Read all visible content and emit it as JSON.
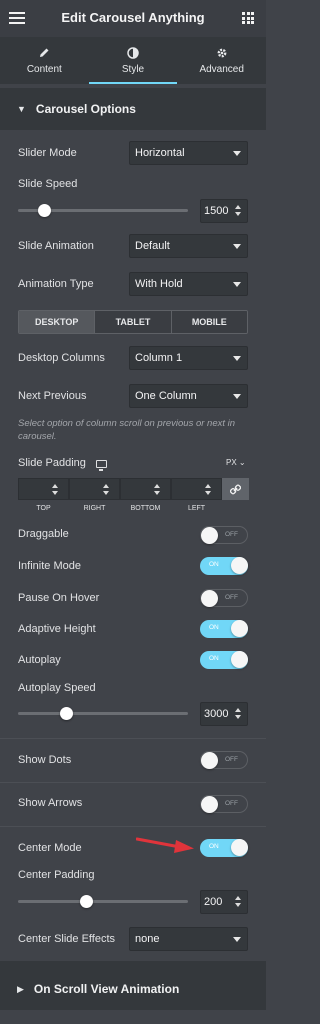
{
  "header": {
    "title": "Edit Carousel Anything"
  },
  "tabs": [
    {
      "label": "Content",
      "icon": "pencil-icon"
    },
    {
      "label": "Style",
      "icon": "contrast-icon"
    },
    {
      "label": "Advanced",
      "icon": "gear-icon"
    }
  ],
  "section": {
    "title": "Carousel Options"
  },
  "slider_mode": {
    "label": "Slider Mode",
    "value": "Horizontal"
  },
  "slide_speed": {
    "label": "Slide Speed",
    "value": "1500",
    "fraction": 0.15
  },
  "slide_animation": {
    "label": "Slide Animation",
    "value": "Default"
  },
  "animation_type": {
    "label": "Animation Type",
    "value": "With Hold"
  },
  "devices": {
    "desktop": "DESKTOP",
    "tablet": "TABLET",
    "mobile": "MOBILE"
  },
  "desktop_columns": {
    "label": "Desktop Columns",
    "value": "Column 1"
  },
  "next_previous": {
    "label": "Next Previous",
    "value": "One Column",
    "hint": "Select option of column scroll on previous or next in carousel."
  },
  "slide_padding": {
    "label": "Slide Padding",
    "unit": "PX",
    "top": "TOP",
    "right": "RIGHT",
    "bottom": "BOTTOM",
    "left": "LEFT"
  },
  "toggles": {
    "draggable": {
      "label": "Draggable",
      "state": "OFF"
    },
    "infinite_mode": {
      "label": "Infinite Mode",
      "state": "ON"
    },
    "pause_on_hover": {
      "label": "Pause On Hover",
      "state": "OFF"
    },
    "adaptive_height": {
      "label": "Adaptive Height",
      "state": "ON"
    },
    "autoplay": {
      "label": "Autoplay",
      "state": "ON"
    },
    "show_dots": {
      "label": "Show Dots",
      "state": "OFF"
    },
    "show_arrows": {
      "label": "Show Arrows",
      "state": "OFF"
    },
    "center_mode": {
      "label": "Center Mode",
      "state": "ON"
    }
  },
  "autoplay_speed": {
    "label": "Autoplay Speed",
    "value": "3000",
    "fraction": 0.28
  },
  "center_padding": {
    "label": "Center Padding",
    "value": "200",
    "fraction": 0.4
  },
  "center_slide_effects": {
    "label": "Center Slide Effects",
    "value": "none"
  },
  "scroll_section": {
    "title": "On Scroll View Animation"
  },
  "colors": {
    "accent": "#71d7f7",
    "panel": "#404349",
    "dark": "#34383c",
    "annotation_arrow": "#e0343b"
  }
}
